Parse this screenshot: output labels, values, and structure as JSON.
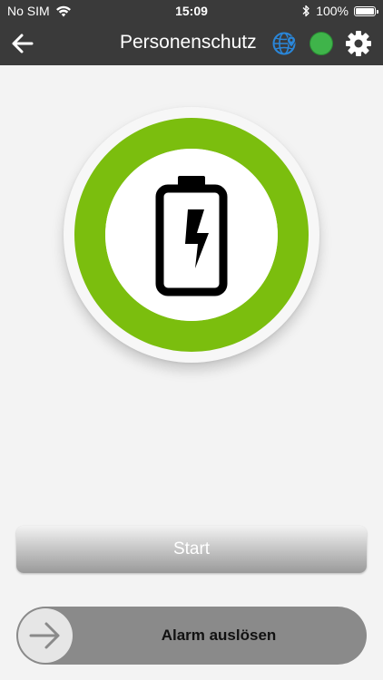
{
  "status_bar": {
    "carrier": "No SIM",
    "time": "15:09",
    "battery_percent": "100%",
    "battery_level": 1.0,
    "icons": [
      "wifi-icon",
      "bluetooth-icon",
      "battery-icon"
    ]
  },
  "nav": {
    "title": "Personenschutz",
    "icons": [
      "back-arrow-icon",
      "globe-location-icon",
      "status-dot-icon",
      "gear-icon"
    ]
  },
  "status_ring": {
    "icon": "battery-charging-icon"
  },
  "buttons": {
    "start_label": "Start",
    "alarm_label": "Alarm auslösen"
  },
  "colors": {
    "header_bg": "#3a3a3a",
    "ring_green": "#7bbe0e",
    "status_green": "#3fb44a",
    "globe_blue": "#2a86d8",
    "slider_gray": "#8a8a8a"
  }
}
